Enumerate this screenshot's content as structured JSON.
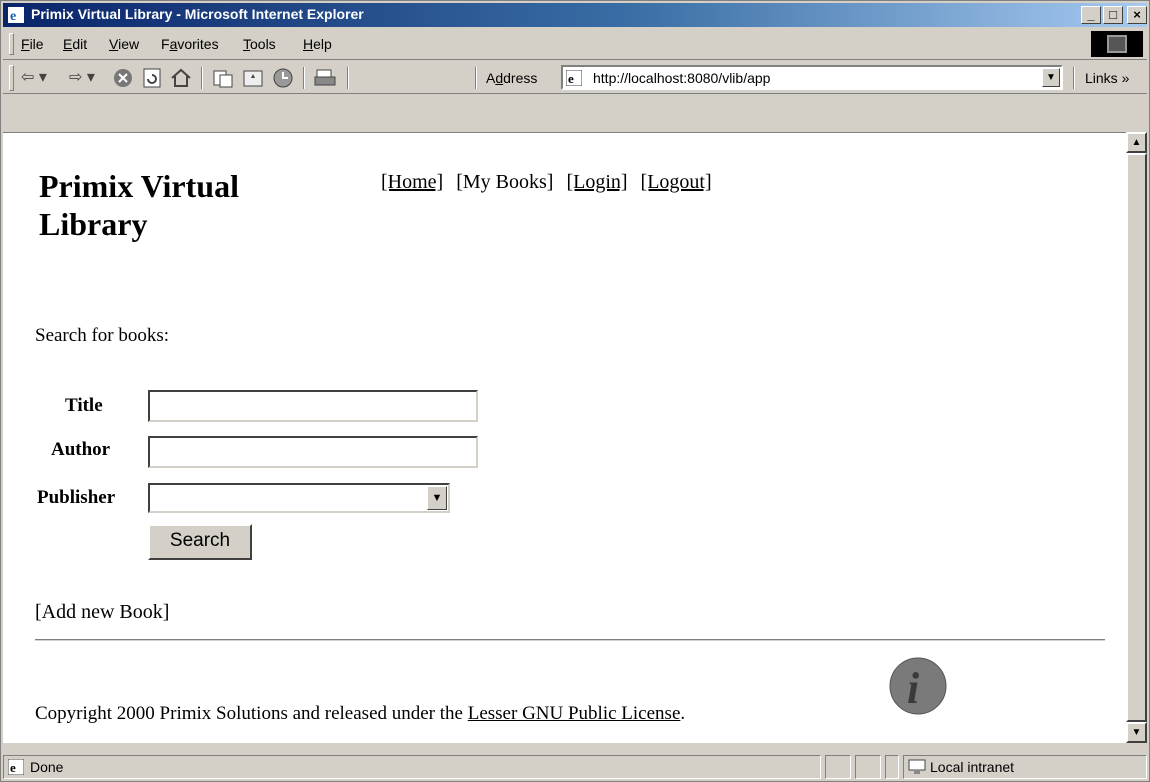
{
  "window": {
    "title": "Primix Virtual Library - Microsoft Internet Explorer",
    "controls": {
      "minimize": "_",
      "maximize": "□",
      "close": "×"
    }
  },
  "menu": {
    "items": [
      {
        "prefix": "",
        "key": "F",
        "rest": "ile"
      },
      {
        "prefix": "",
        "key": "E",
        "rest": "dit"
      },
      {
        "prefix": "",
        "key": "V",
        "rest": "iew"
      },
      {
        "prefix": "F",
        "key": "a",
        "rest": "vorites"
      },
      {
        "prefix": "",
        "key": "T",
        "rest": "ools"
      },
      {
        "prefix": "",
        "key": "H",
        "rest": "elp"
      }
    ]
  },
  "toolbar": {
    "address_prefix": "A",
    "address_key": "d",
    "address_rest": "dress",
    "url": "http://localhost:8080/vlib/app",
    "links": "Links »"
  },
  "page": {
    "site_title": "Primix Virtual Library",
    "nav": {
      "home": "[Home]",
      "my_books": "[My Books]",
      "login": "[Login]",
      "logout": "[Logout]"
    },
    "search_prompt": "Search for books:",
    "form": {
      "title_label": "Title",
      "title_value": "",
      "author_label": "Author",
      "author_value": "",
      "publisher_label": "Publisher",
      "publisher_selected": "",
      "search_button": "Search"
    },
    "add_book": "[Add new Book]",
    "footer": {
      "text_before": "Copyright 2000 Primix Solutions and released under the ",
      "license_link": "Lesser GNU Public License",
      "text_after": "."
    }
  },
  "status": {
    "left": "Done",
    "zone": "Local intranet"
  },
  "colors": {
    "title_bar_start": "#0a246a",
    "title_bar_end": "#a6caf0",
    "chrome": "#d4d0c8",
    "info_badge": "#7a7a7a"
  }
}
